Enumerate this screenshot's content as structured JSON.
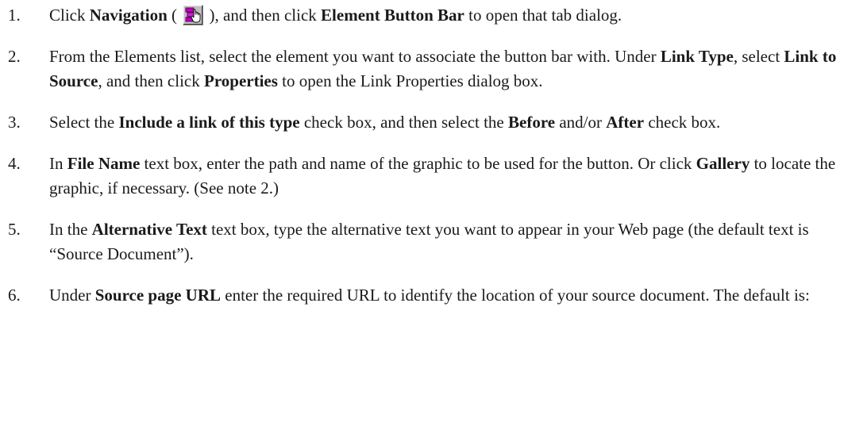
{
  "steps": [
    {
      "number": "1.",
      "segments": [
        {
          "t": "Click "
        },
        {
          "b": "Navigation"
        },
        {
          "t": " ("
        },
        {
          "icon": "navigation-icon"
        },
        {
          "t": "), and then click "
        },
        {
          "b": "Element Button Bar"
        },
        {
          "t": " to open that tab dialog."
        }
      ]
    },
    {
      "number": "2.",
      "segments": [
        {
          "t": "From the Elements list, select the element you want to associate the button bar with. Under "
        },
        {
          "b": "Link Type"
        },
        {
          "t": ", select "
        },
        {
          "b": "Link to Source"
        },
        {
          "t": ", and then click "
        },
        {
          "b": "Properties"
        },
        {
          "t": " to open the Link Properties dialog box."
        }
      ]
    },
    {
      "number": "3.",
      "segments": [
        {
          "t": "Select the "
        },
        {
          "b": "Include a link of this type"
        },
        {
          "t": " check box, and then select the "
        },
        {
          "b": "Before"
        },
        {
          "t": " and/or "
        },
        {
          "b": "After"
        },
        {
          "t": " check box."
        }
      ]
    },
    {
      "number": "4.",
      "segments": [
        {
          "t": "In "
        },
        {
          "b": "File Name"
        },
        {
          "t": " text box, enter the path and name of the graphic to be used for the button. Or click "
        },
        {
          "b": "Gallery"
        },
        {
          "t": " to locate the graphic, if necessary. (See note 2.)"
        }
      ]
    },
    {
      "number": "5.",
      "segments": [
        {
          "t": "In the "
        },
        {
          "b": "Alternative Text"
        },
        {
          "t": " text box, type the alternative text you want to appear in your Web page (the default text is “Source Document”)."
        }
      ]
    },
    {
      "number": "6.",
      "segments": [
        {
          "t": "Under "
        },
        {
          "b": "Source page URL"
        },
        {
          "t": " enter the required URL to identify the location of your source document. The default is:"
        }
      ]
    }
  ]
}
